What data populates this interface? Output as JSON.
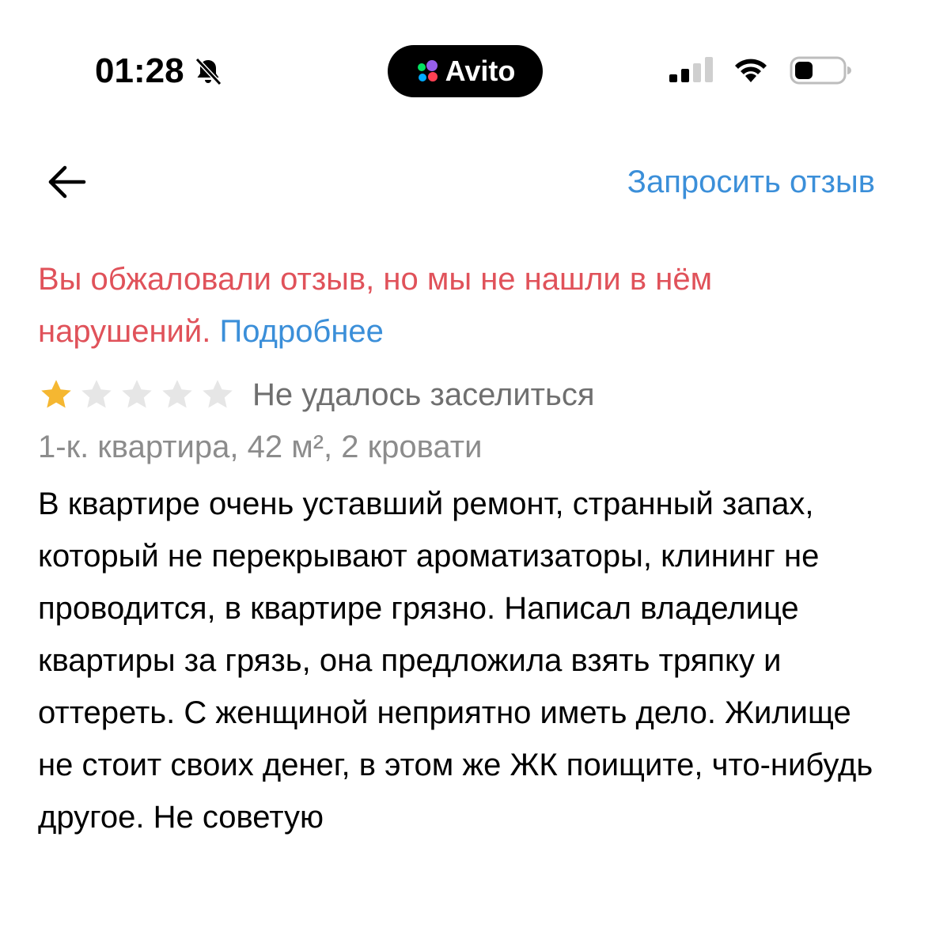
{
  "status_bar": {
    "time": "01:28",
    "island_app": "Avito",
    "icons": [
      "bell-slash-icon",
      "cellular-signal-icon",
      "wifi-icon",
      "battery-icon"
    ]
  },
  "nav": {
    "back_icon": "arrow-left-icon",
    "request_review_label": "Запросить отзыв"
  },
  "appeal": {
    "notice": "Вы обжаловали отзыв, но мы не нашли в нём нарушений.",
    "more_link": "Подробнее"
  },
  "review": {
    "rating": 1,
    "max_rating": 5,
    "title": "Не удалось заселиться",
    "listing": "1-к. квартира, 42 м², 2 кровати",
    "text": "В квартире очень уставший ремонт, странный запах, который не перекрывают ароматизаторы, клининг не проводится, в квартире грязно. Написал владелице квартиры за грязь, она предложила взять тряпку и оттереть. С женщиной неприятно иметь дело. Жилище не стоит своих денег, в этом же ЖК поищите, что-нибудь другое. Не советую"
  },
  "colors": {
    "link_blue": "#3b8fd9",
    "warning_red": "#e0525a",
    "star_filled": "#f5b731",
    "star_empty": "#e6e6e6",
    "muted_text": "#8c8c8c"
  }
}
